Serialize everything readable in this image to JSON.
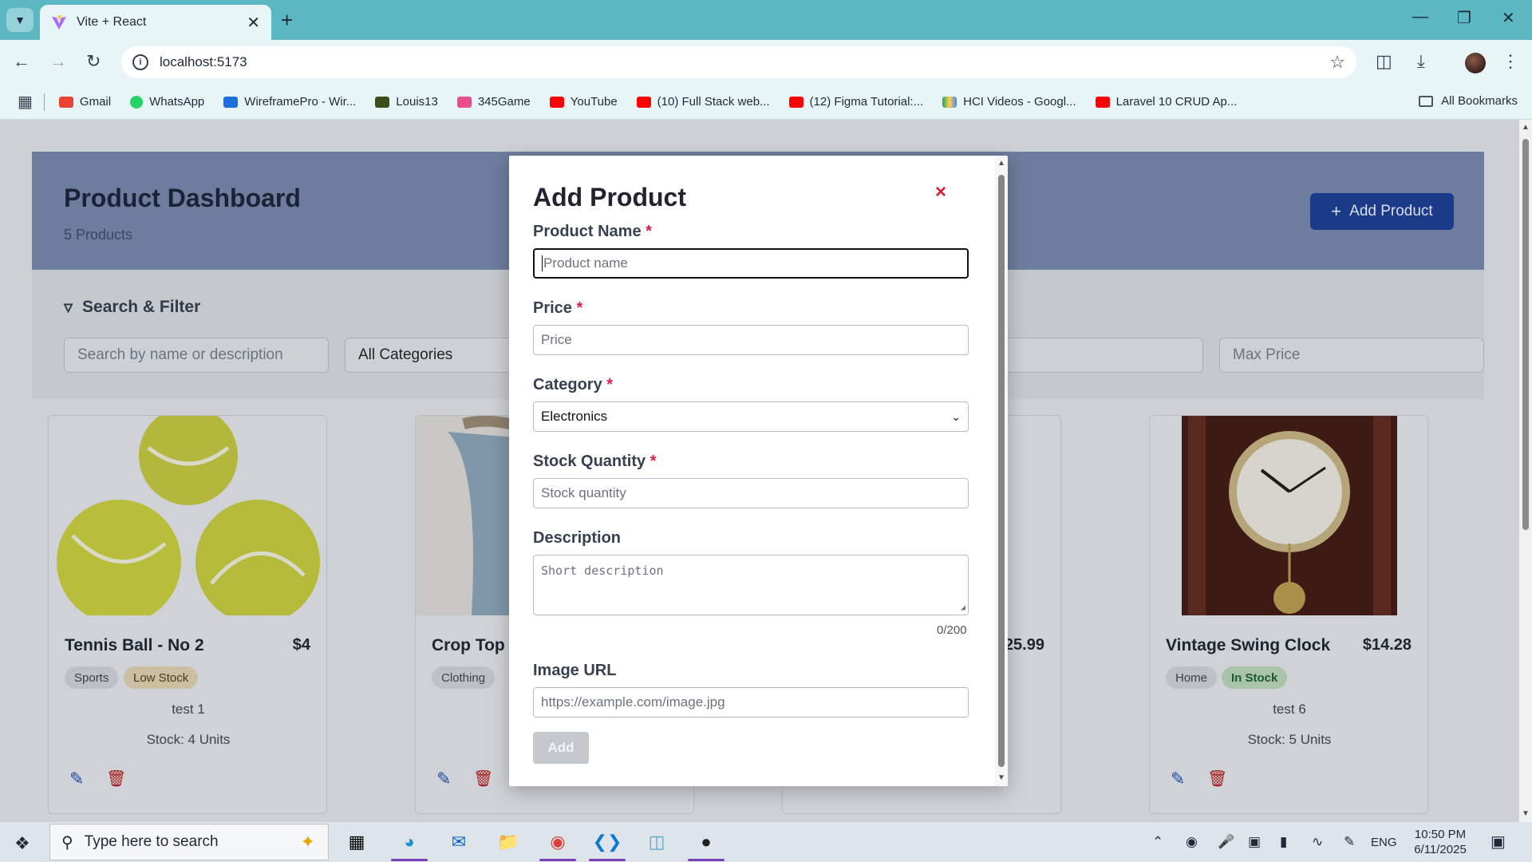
{
  "browser": {
    "tab_title": "Vite + React",
    "url": "localhost:5173",
    "bookmarks": [
      {
        "label": "Gmail",
        "color": "#ea4335"
      },
      {
        "label": "WhatsApp",
        "color": "#25d366"
      },
      {
        "label": "WireframePro - Wir...",
        "color": "#1e6fd9"
      },
      {
        "label": "Louis13",
        "color": "#2b2b2b"
      },
      {
        "label": "345Game",
        "color": "#e84f8a"
      },
      {
        "label": "YouTube",
        "color": "#ff0000"
      },
      {
        "label": "(10) Full Stack web...",
        "color": "#ff0000"
      },
      {
        "label": "(12) Figma Tutorial:...",
        "color": "#ff0000"
      },
      {
        "label": "HCI Videos - Googl...",
        "color": "#1fa463"
      },
      {
        "label": "Laravel 10 CRUD Ap...",
        "color": "#ff0000"
      }
    ],
    "all_bookmarks": "All Bookmarks"
  },
  "dashboard": {
    "title": "Product Dashboard",
    "count": "5 Products",
    "add_button": "Add Product"
  },
  "filter": {
    "title": "Search & Filter",
    "search_placeholder": "Search by name or description",
    "category_value": "All Categories",
    "max_price_placeholder": "Max Price"
  },
  "cards": [
    {
      "name": "Tennis Ball - No 2",
      "price": "$4",
      "category": "Sports",
      "stock_badge": "Low Stock",
      "description": "test 1",
      "stock": "Stock: 4 Units"
    },
    {
      "name": "Crop Top",
      "price": "",
      "category": "Clothing",
      "stock_badge": "",
      "description": "",
      "stock": ""
    },
    {
      "name": "",
      "price": "25.99",
      "category": "",
      "stock_badge": "",
      "description": "",
      "stock": ""
    },
    {
      "name": "Vintage Swing Clock",
      "price": "$14.28",
      "category": "Home",
      "stock_badge": "In Stock",
      "description": "test 6",
      "stock": "Stock: 5 Units"
    }
  ],
  "modal": {
    "title": "Add Product",
    "close": "×",
    "product_name_label": "Product Name",
    "product_name_placeholder": "Product name",
    "price_label": "Price",
    "price_placeholder": "Price",
    "category_label": "Category",
    "category_value": "Electronics",
    "stock_label": "Stock Quantity",
    "stock_placeholder": "Stock quantity",
    "description_label": "Description",
    "description_placeholder": "Short description",
    "char_count": "0/200",
    "image_label": "Image URL",
    "image_placeholder": "https://example.com/image.jpg",
    "submit": "Add",
    "required_mark": "*"
  },
  "taskbar": {
    "search_placeholder": "Type here to search",
    "language": "ENG",
    "time": "10:50 PM",
    "date": "6/11/2025",
    "notifications": "1"
  }
}
